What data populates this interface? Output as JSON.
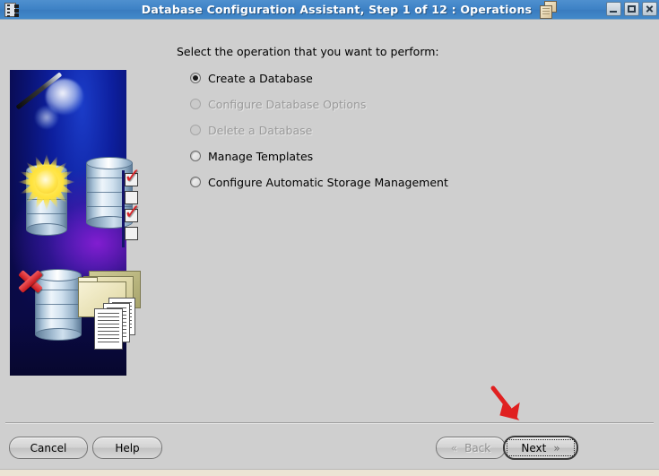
{
  "window": {
    "title": "Database Configuration Assistant, Step 1 of 12 : Operations",
    "app_icon": "film-strip-icon",
    "doc_icon": "document-stack-icon",
    "controls": {
      "minimize": "Minimize",
      "maximize": "Maximize",
      "close": "Close"
    }
  },
  "main": {
    "prompt": "Select the operation that you want to perform:",
    "options": [
      {
        "label": "Create a Database",
        "selected": true,
        "disabled": false
      },
      {
        "label": "Configure Database Options",
        "selected": false,
        "disabled": true
      },
      {
        "label": "Delete a Database",
        "selected": false,
        "disabled": true
      },
      {
        "label": "Manage Templates",
        "selected": false,
        "disabled": false
      },
      {
        "label": "Configure Automatic Storage Management",
        "selected": false,
        "disabled": false
      }
    ]
  },
  "banner": {
    "name": "database-wizard-illustration",
    "elements": [
      "magic-wand-icon",
      "star-burst-icon",
      "database-cylinder-icon",
      "checklist-icon",
      "red-x-icon",
      "folder-stack-icon",
      "document-stack-icon"
    ]
  },
  "annotation": {
    "arrow": "red-arrow-pointing-to-next",
    "color": "#e02020"
  },
  "footer": {
    "cancel": "Cancel",
    "help": "Help",
    "back": "Back",
    "next": "Next",
    "back_chevron": "«",
    "next_chevron": "»",
    "back_disabled": true,
    "next_focused": true
  },
  "colors": {
    "titlebar": "#3f83c6",
    "window_bg": "#cfcfcf",
    "banner_blue": "#0d1f9e",
    "accent_red": "#d8252a",
    "status_strip": "#ece4d4"
  }
}
